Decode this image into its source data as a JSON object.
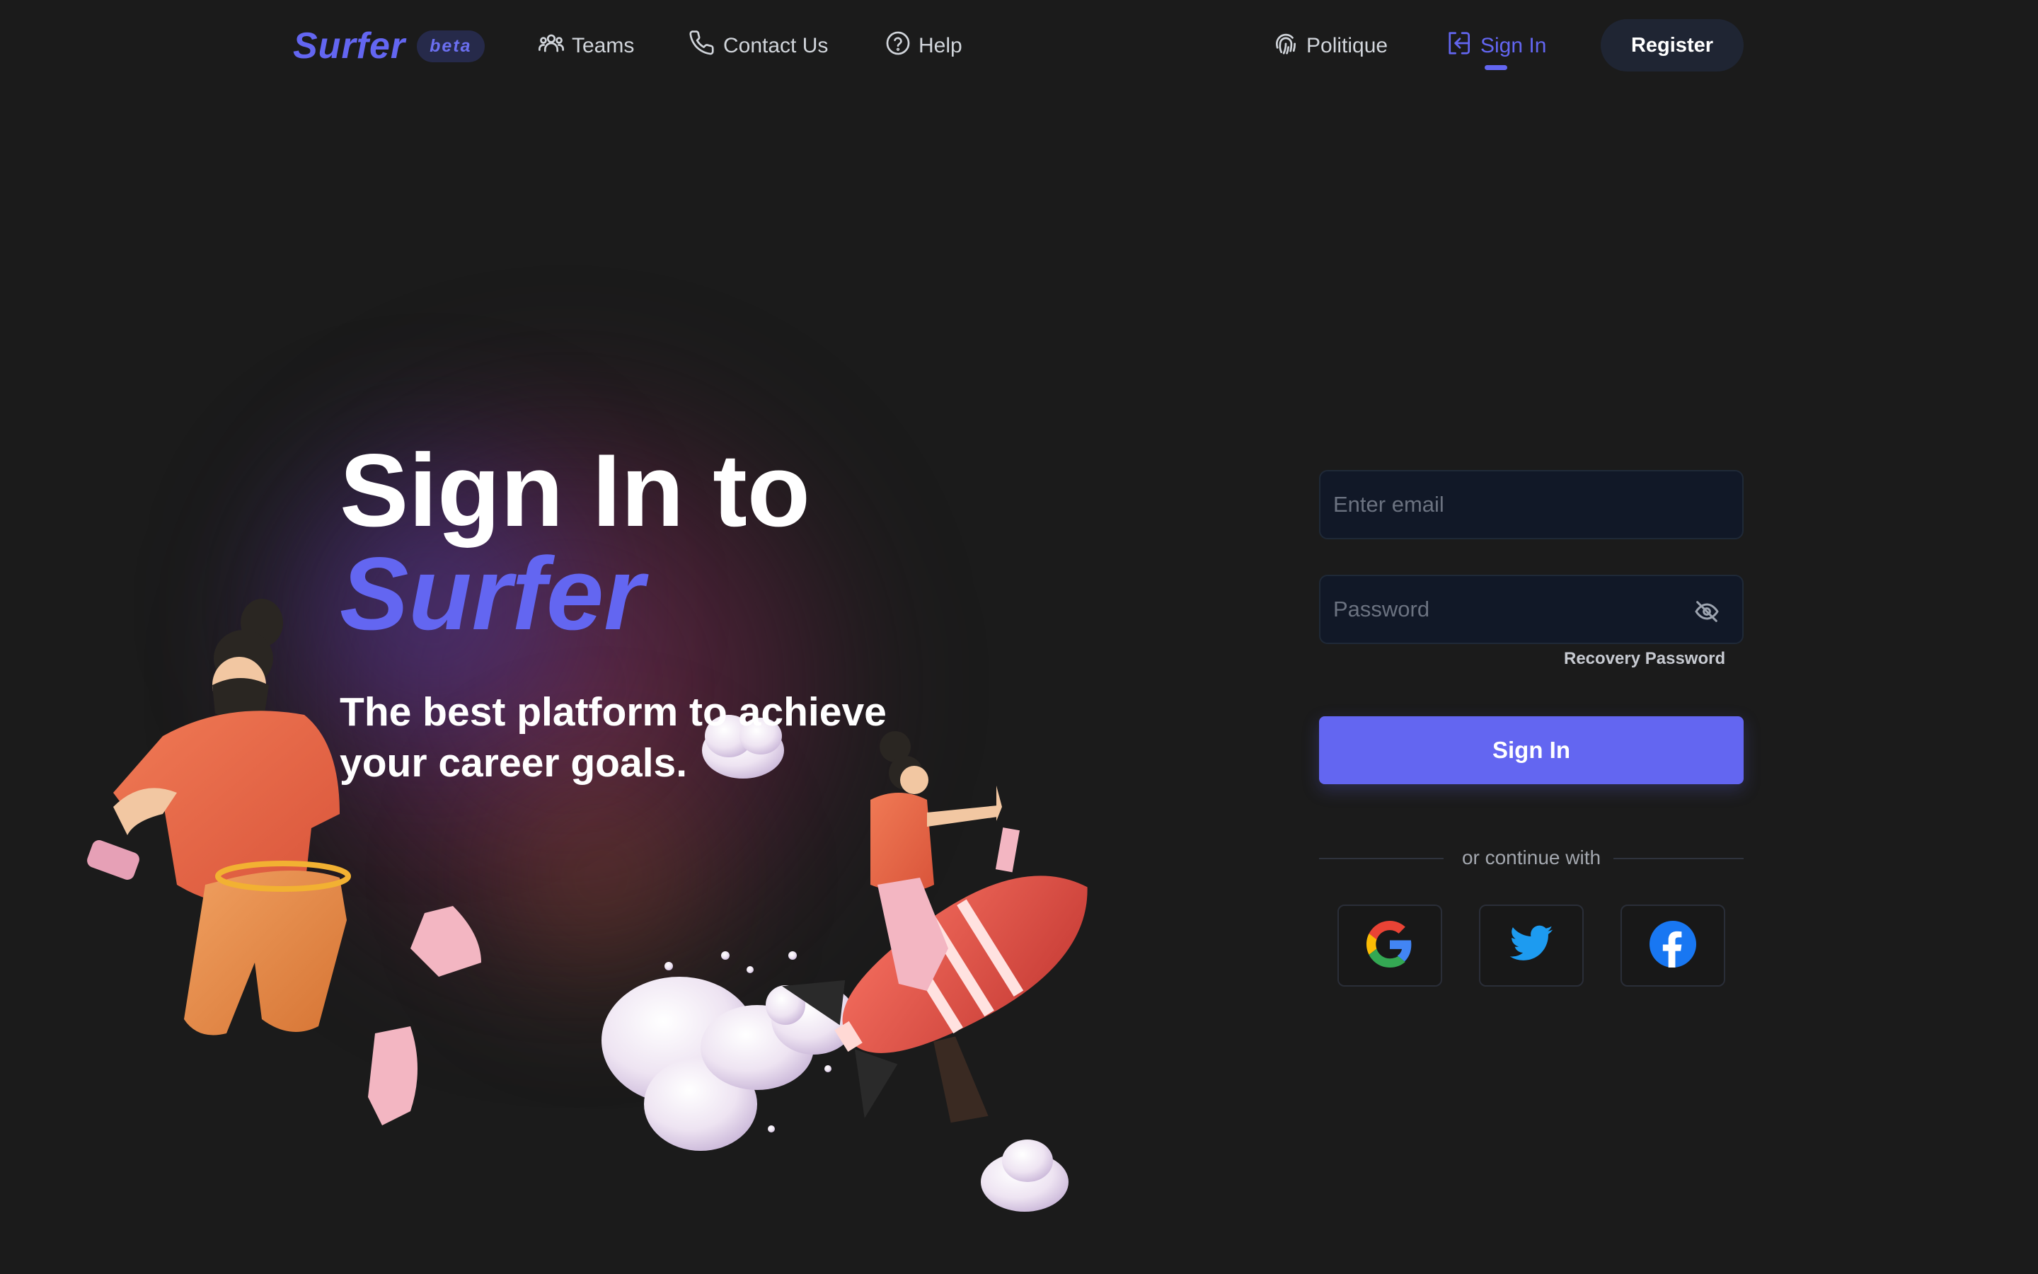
{
  "nav": {
    "logo": "Surfer",
    "badge": "beta",
    "items": [
      {
        "label": "Teams",
        "icon": "users-icon"
      },
      {
        "label": "Contact Us",
        "icon": "phone-icon"
      },
      {
        "label": "Help",
        "icon": "question-circle-icon"
      },
      {
        "label": "Politique",
        "icon": "fingerprint-icon"
      },
      {
        "label": "Sign In",
        "icon": "sign-in-icon",
        "active": true
      }
    ],
    "register_label": "Register"
  },
  "hero": {
    "title_line1": "Sign In to",
    "title_line2": "Surfer",
    "subtitle": "The best platform to achieve your career goals."
  },
  "form": {
    "email_placeholder": "Enter email",
    "email_value": "",
    "password_placeholder": "Password",
    "password_value": "",
    "recovery_label": "Recovery Password",
    "signin_label": "Sign In",
    "divider_text": "or continue with",
    "social": [
      "google-icon",
      "twitter-icon",
      "facebook-icon"
    ]
  },
  "colors": {
    "accent": "#6366f1",
    "background": "#1b1b1b",
    "field_bg": "#111827",
    "register_bg": "#1f2533"
  }
}
